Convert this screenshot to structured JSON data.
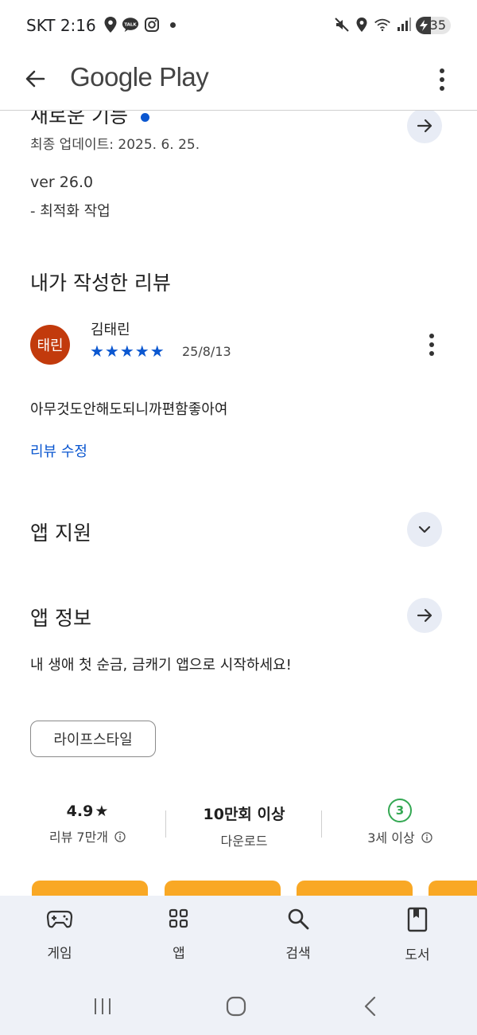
{
  "status_bar": {
    "carrier_time": "SKT 2:16",
    "talk_badge": "TALK",
    "battery_level": "35",
    "icons": [
      "location-pin-icon",
      "kakaotalk-icon",
      "instagram-icon",
      "mute-icon",
      "wifi-icon",
      "signal-icon",
      "battery-icon"
    ]
  },
  "app_bar": {
    "title": "Google Play",
    "icons": [
      "back-arrow-icon",
      "more-vert-icon"
    ]
  },
  "whats_new": {
    "heading": "새로운 기능",
    "updated": "최종 업데이트: 2025. 6. 25.",
    "version": "ver 26.0",
    "note": "- 최적화 작업",
    "accent": "#0b57d0"
  },
  "my_review": {
    "heading": "내가 작성한 리뷰",
    "avatar_text": "태린",
    "avatar_color": "#c23a0c",
    "reviewer": "김태린",
    "stars": "★★★★★",
    "rating": 5,
    "date": "25/8/13",
    "text": "아무것도안해도되니까편함좋아여",
    "edit_link": "리뷰 수정"
  },
  "app_support": {
    "heading": "앱 지원"
  },
  "app_info": {
    "heading": "앱 정보",
    "description": "내 생애 첫 순금, 금캐기 앱으로 시작하세요!",
    "category_chip": "라이프스타일"
  },
  "stats": {
    "rating_value": "4.9",
    "rating_star": "★",
    "rating_label": "리뷰 7만개",
    "downloads_value": "10만회 이상",
    "downloads_label": "다운로드",
    "age_badge": "3",
    "age_label": "3세 이상"
  },
  "bottom_nav": {
    "items": [
      {
        "label": "게임",
        "icon": "gamepad-icon"
      },
      {
        "label": "앱",
        "icon": "apps-grid-icon"
      },
      {
        "label": "검색",
        "icon": "search-icon"
      },
      {
        "label": "도서",
        "icon": "book-icon"
      }
    ]
  },
  "system_nav": {
    "icons": [
      "recents-icon",
      "home-icon",
      "back-icon"
    ]
  }
}
